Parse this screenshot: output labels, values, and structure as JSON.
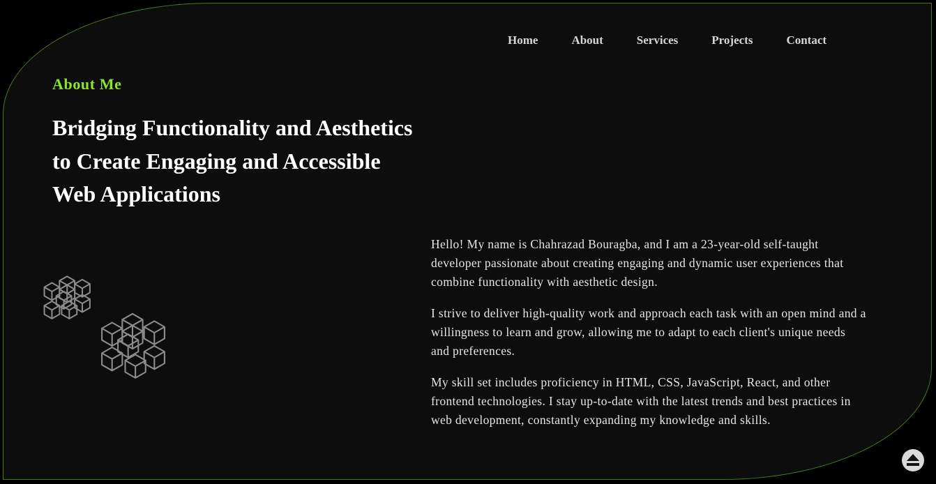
{
  "nav": {
    "items": [
      {
        "label": "Home"
      },
      {
        "label": "About"
      },
      {
        "label": "Services"
      },
      {
        "label": "Projects"
      },
      {
        "label": "Contact"
      }
    ]
  },
  "about": {
    "eyebrow": "About Me",
    "headline_lines": [
      "Bridging Functionality and Aesthetics",
      "to Create Engaging and Accessible",
      "Web Applications"
    ],
    "paragraphs": [
      "Hello! My name is Chahrazad Bouragba, and I am a 23-year-old self-taught developer passionate about creating engaging and dynamic user experiences that combine functionality with aesthetic design.",
      "I strive to deliver high-quality work and approach each task with an open mind and a willingness to learn and grow, allowing me to adapt to each client's unique needs and preferences.",
      "My skill set includes proficiency in HTML, CSS, JavaScript, React, and other frontend technologies. I stay up-to-date with the latest trends and best practices in web development, constantly expanding my knowledge and skills."
    ]
  },
  "icons": {
    "decor": "cubes-icon",
    "scroll_top": "eject-icon"
  },
  "colors": {
    "background": "#000000",
    "panel": "#0d0d0d",
    "border": "#4a7a1e",
    "accent": "#8ee62b",
    "text": "#ffffff"
  }
}
